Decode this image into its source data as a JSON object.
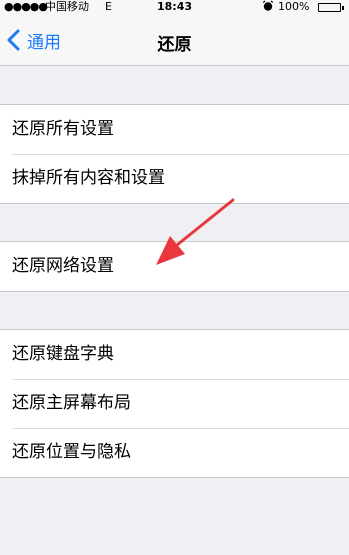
{
  "status_bar": {
    "signal": "●●●●●",
    "carrier": "中国移动",
    "network": "E",
    "time": "18:43",
    "battery_percent": "100%",
    "alarm_icon": "alarm-clock-icon"
  },
  "nav": {
    "back_label": "通用",
    "title": "还原"
  },
  "groups": [
    {
      "items": [
        "还原所有设置",
        "抹掉所有内容和设置"
      ]
    },
    {
      "items": [
        "还原网络设置"
      ]
    },
    {
      "items": [
        "还原键盘字典",
        "还原主屏幕布局",
        "还原位置与隐私"
      ]
    }
  ],
  "colors": {
    "accent": "#1a7cfb",
    "annotation_arrow": "#e8383d",
    "background": "#efeff4"
  }
}
